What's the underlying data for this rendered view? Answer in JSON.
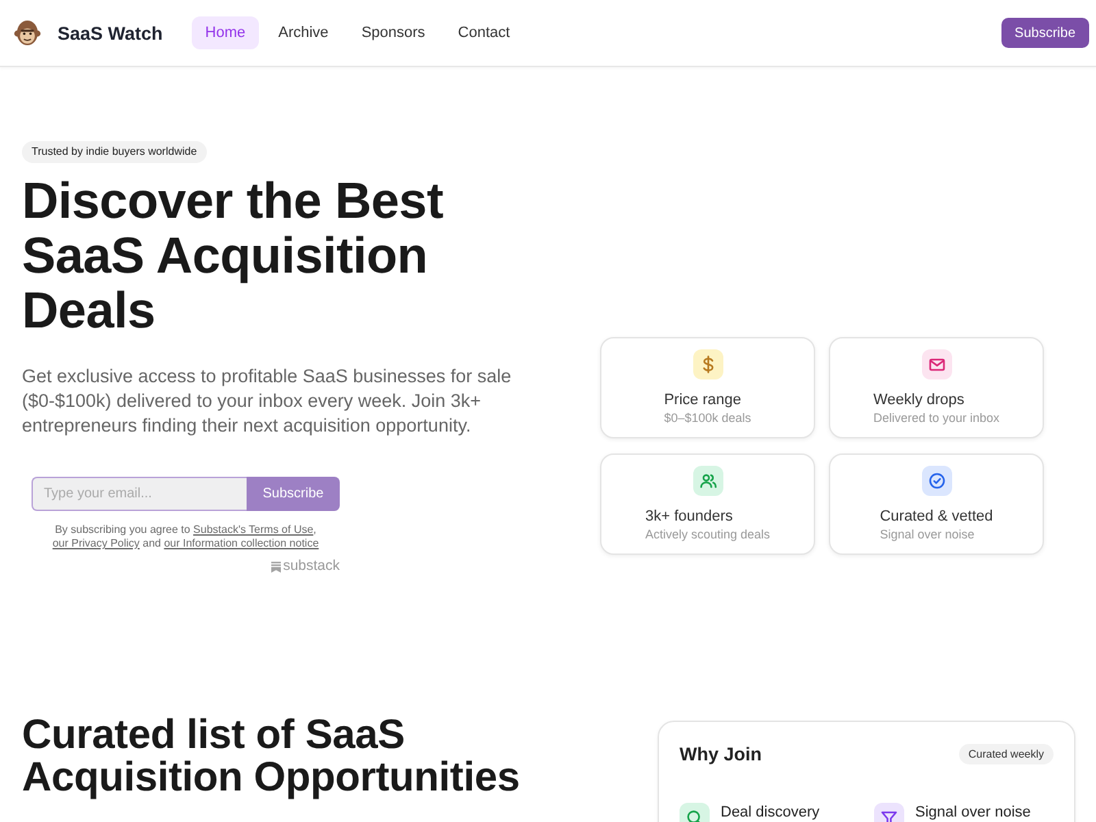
{
  "header": {
    "brand": "SaaS Watch",
    "nav": [
      {
        "label": "Home",
        "selected": true
      },
      {
        "label": "Archive",
        "selected": false
      },
      {
        "label": "Sponsors",
        "selected": false
      },
      {
        "label": "Contact",
        "selected": false
      }
    ],
    "subscribe_button": "Subscribe"
  },
  "hero": {
    "badge": "Trusted by indie buyers worldwide",
    "title": "Discover the Best SaaS Acquisition Deals",
    "description": "Get exclusive access to profitable SaaS businesses for sale ($0-$100k) delivered to your inbox every week. Join 3k+ entrepreneurs finding their next acquisition opportunity.",
    "signup": {
      "placeholder": "Type your email...",
      "button": "Subscribe",
      "disclaimer": [
        {
          "kind": "text",
          "text": "By subscribing you agree to "
        },
        {
          "kind": "link",
          "text": "Substack's Terms of Use"
        },
        {
          "kind": "text",
          "text": ", "
        },
        {
          "kind": "link",
          "text": "our Privacy Policy"
        },
        {
          "kind": "text",
          "text": " and "
        },
        {
          "kind": "link",
          "text": "our Information collection notice"
        }
      ],
      "brand": "substack"
    }
  },
  "features": [
    {
      "kind": "dollar",
      "title": "Price range",
      "subtitle": "$0–$100k deals"
    },
    {
      "kind": "mail",
      "title": "Weekly drops",
      "subtitle": "Delivered to your inbox"
    },
    {
      "kind": "users",
      "title": "3k+ founders",
      "subtitle": "Actively scouting deals"
    },
    {
      "kind": "check",
      "title": "Curated & vetted",
      "subtitle": "Signal over noise"
    }
  ],
  "section": {
    "title": "Curated list of SaaS Acquisition Opportunities",
    "why_join": {
      "title": "Why Join",
      "badge": "Curated weekly",
      "items": [
        {
          "kind": "search",
          "label": "Deal discovery"
        },
        {
          "kind": "filter",
          "label": "Signal over noise"
        }
      ]
    }
  }
}
